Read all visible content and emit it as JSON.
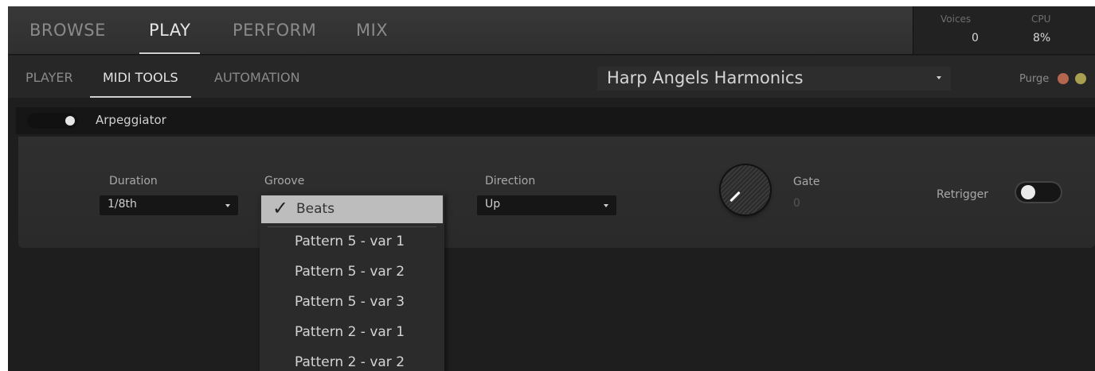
{
  "main_tabs": [
    {
      "label": "BROWSE",
      "active": false
    },
    {
      "label": "PLAY",
      "active": true
    },
    {
      "label": "PERFORM",
      "active": false
    },
    {
      "label": "MIX",
      "active": false
    }
  ],
  "stats": {
    "voices_label": "Voices",
    "voices_value": "0",
    "cpu_label": "CPU",
    "cpu_value": "8%"
  },
  "sub_tabs": [
    {
      "label": "PLAYER",
      "active": false
    },
    {
      "label": "MIDI TOOLS",
      "active": true
    },
    {
      "label": "AUTOMATION",
      "active": false
    }
  ],
  "preset": {
    "name": "Harp Angels Harmonics"
  },
  "purge": {
    "label": "Purge"
  },
  "arpeggiator": {
    "title": "Arpeggiator",
    "enabled": true,
    "duration": {
      "label": "Duration",
      "value": "1/8th"
    },
    "groove": {
      "label": "Groove",
      "value": "Beats"
    },
    "direction": {
      "label": "Direction",
      "value": "Up"
    },
    "gate": {
      "label": "Gate",
      "value": "0"
    },
    "retrigger": {
      "label": "Retrigger",
      "on": false
    }
  },
  "groove_menu": {
    "selected": "Beats",
    "check_icon": "checkmark-icon",
    "items": [
      "Pattern 5 - var 1",
      "Pattern 5 - var 2",
      "Pattern 5 - var 3",
      "Pattern 2 - var 1",
      "Pattern 2 - var 2"
    ]
  },
  "colors": {
    "background": "#1e1e1e",
    "menu_highlight": "#bdbdbd",
    "led_left": "#b5664f",
    "led_right": "#a8a050"
  }
}
